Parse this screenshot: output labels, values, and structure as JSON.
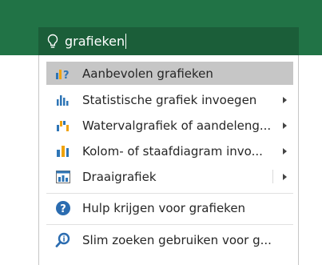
{
  "colors": {
    "ribbon_green": "#217346",
    "search_green": "#1b5e39",
    "selected_bg": "#c6c6c6",
    "chart_blue": "#2e75b6",
    "chart_orange": "#f0a30a",
    "help_blue": "#2b6cb0"
  },
  "search": {
    "icon": "lightbulb-icon",
    "value": "grafieken"
  },
  "menu": {
    "items": [
      {
        "label": "Aanbevolen grafieken",
        "icon": "recommended-charts-icon",
        "submenu": false,
        "selected": true
      },
      {
        "label": "Statistische grafiek invoegen",
        "icon": "statistic-chart-icon",
        "submenu": true
      },
      {
        "label": "Watervalgrafiek of aandeleng...",
        "icon": "waterfall-chart-icon",
        "submenu": true
      },
      {
        "label": "Kolom- of staafdiagram invo...",
        "icon": "column-chart-icon",
        "submenu": true
      },
      {
        "label": "Draaigrafiek",
        "icon": "pivot-chart-icon",
        "submenu": true,
        "split": true
      }
    ],
    "help_items": [
      {
        "label": "Hulp krijgen voor grafieken",
        "icon": "help-icon"
      },
      {
        "label": "Slim zoeken gebruiken voor g...",
        "icon": "smart-lookup-icon"
      }
    ]
  }
}
